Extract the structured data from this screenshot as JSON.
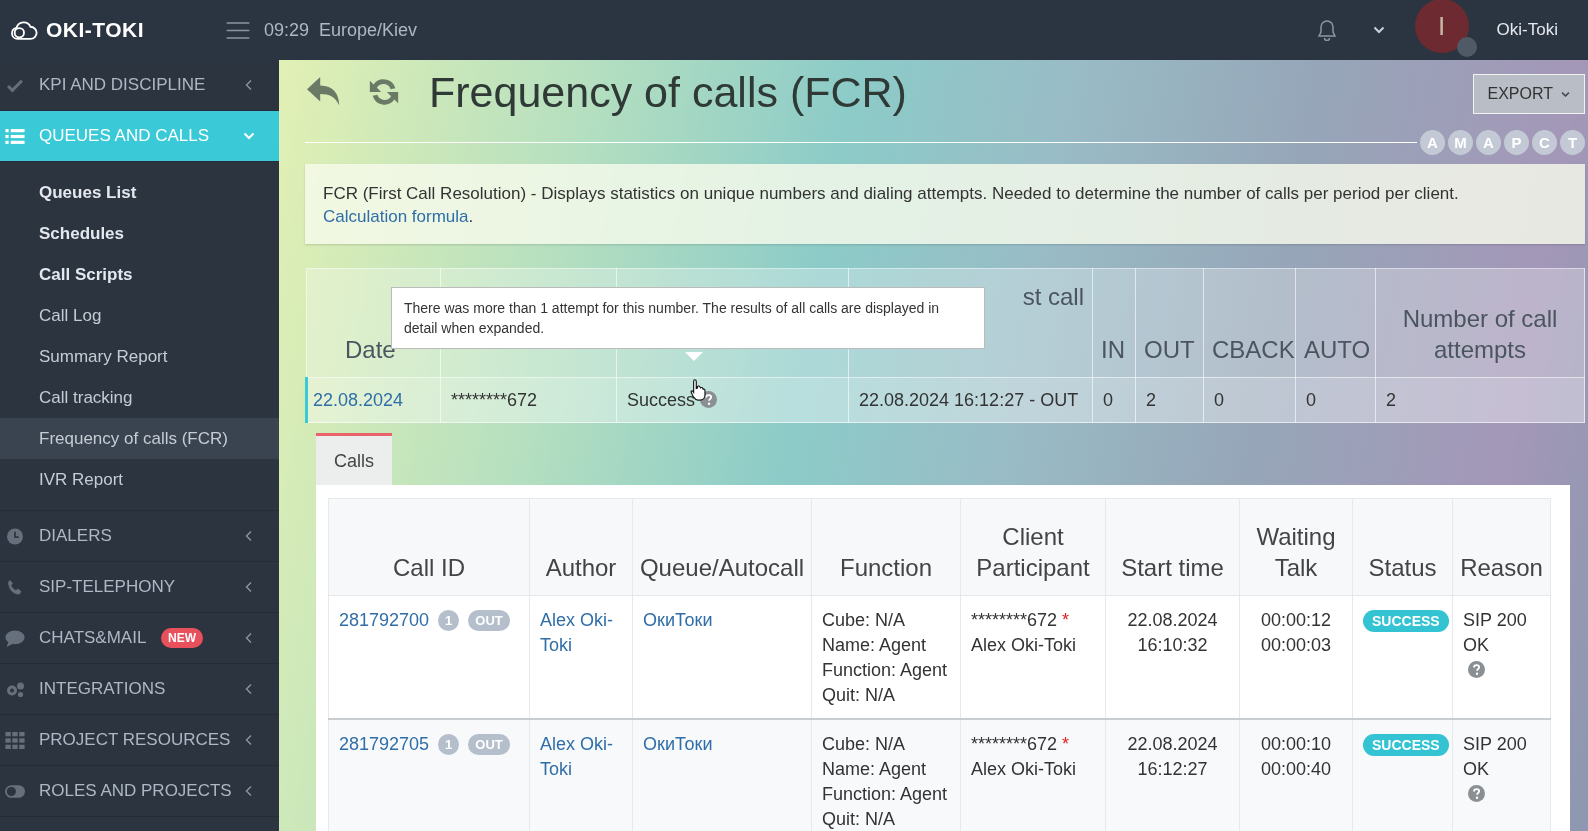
{
  "topbar": {
    "logo": "OKI-TOKI",
    "time": "09:29",
    "timezone": "Europe/Kiev",
    "avatar_letter": "I",
    "user": "Oki-Toki"
  },
  "sidebar": {
    "items": [
      {
        "label": "KPI AND DISCIPLINE",
        "expanded": false,
        "selected": false
      },
      {
        "label": "QUEUES AND CALLS",
        "expanded": true,
        "selected": true,
        "children": [
          {
            "label": "Queues List",
            "bold": true,
            "selected": false
          },
          {
            "label": "Schedules",
            "bold": true,
            "selected": false
          },
          {
            "label": "Call Scripts",
            "bold": true,
            "selected": false
          },
          {
            "label": "Call Log",
            "bold": false,
            "selected": false
          },
          {
            "label": "Summary Report",
            "bold": false,
            "selected": false
          },
          {
            "label": "Call tracking",
            "bold": false,
            "selected": false
          },
          {
            "label": "Frequency of calls (FCR)",
            "bold": false,
            "selected": true
          },
          {
            "label": "IVR Report",
            "bold": false,
            "selected": false
          }
        ]
      },
      {
        "label": "DIALERS",
        "expanded": false,
        "selected": false
      },
      {
        "label": "SIP-TELEPHONY",
        "expanded": false,
        "selected": false
      },
      {
        "label": "CHATS&MAIL",
        "badge": "NEW",
        "expanded": false,
        "selected": false
      },
      {
        "label": "INTEGRATIONS",
        "expanded": false,
        "selected": false
      },
      {
        "label": "PROJECT RESOURCES",
        "expanded": false,
        "selected": false
      },
      {
        "label": "ROLES AND PROJECTS",
        "expanded": false,
        "selected": false
      }
    ]
  },
  "page": {
    "title": "Frequency of calls (FCR)",
    "export": "EXPORT",
    "letters": [
      "A",
      "M",
      "A",
      "P",
      "C",
      "T"
    ],
    "info": {
      "text": "FCR (First Call Resolution) - Displays statistics on unique numbers and dialing attempts. Needed to determine the number of calls per period per client.",
      "link": "Calculation formula",
      "end": "."
    }
  },
  "summary": {
    "header_start": [
      "Date"
    ],
    "header_end": [
      "st call",
      "IN",
      "OUT",
      "CBACK",
      "AUTO",
      "Number of call attempts"
    ],
    "rows": [
      {
        "date": "22.08.2024",
        "number": "********672",
        "result": "Success",
        "last_call": "22.08.2024 16:12:27 - OUT",
        "in": "0",
        "out": "2",
        "cback": "0",
        "auto": "0",
        "attempts": "2"
      }
    ],
    "tooltip": "There was more than 1 attempt for this number. The results of all calls are displayed in detail when expanded."
  },
  "tabs": [
    {
      "label": "Calls",
      "selected": true
    }
  ],
  "calls": {
    "columns": [
      "Call ID",
      "Author",
      "Queue/Autocall",
      "Function",
      "Client Participant",
      "Start time",
      "Waiting Talk",
      "Status",
      "Reason"
    ],
    "rows": [
      {
        "call_id": "281792700",
        "count": "1",
        "direction": "OUT",
        "author": "Alex Oki-Toki",
        "queue": "ОкиТоки",
        "function": [
          "Cube: N/A",
          "Name: Agent",
          "Function: Agent",
          "Quit: N/A"
        ],
        "client": "********672",
        "client_mark": "*",
        "participant": "Alex Oki-Toki",
        "start_date": "22.08.2024",
        "start_time": "16:10:32",
        "waiting": "00:00:12",
        "talk": "00:00:03",
        "status": "SUCCESS",
        "reason": "SIP 200 OK"
      },
      {
        "call_id": "281792705",
        "count": "1",
        "direction": "OUT",
        "author": "Alex Oki-Toki",
        "queue": "ОкиТоки",
        "function": [
          "Cube: N/A",
          "Name: Agent",
          "Function: Agent",
          "Quit: N/A"
        ],
        "client": "********672",
        "client_mark": "*",
        "participant": "Alex Oki-Toki",
        "start_date": "22.08.2024",
        "start_time": "16:12:27",
        "waiting": "00:00:10",
        "talk": "00:00:40",
        "status": "SUCCESS",
        "reason": "SIP 200 OK"
      }
    ]
  }
}
